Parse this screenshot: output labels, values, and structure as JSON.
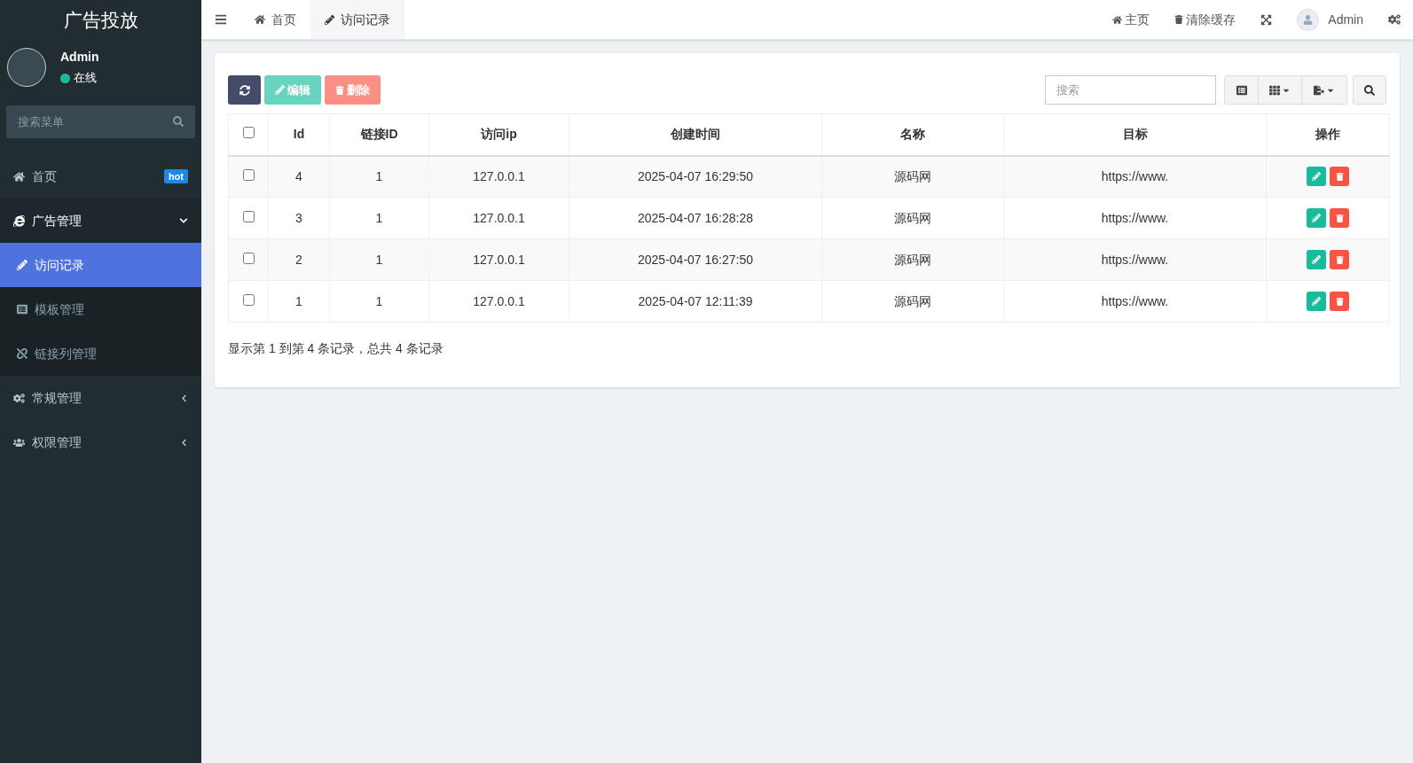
{
  "sidebar": {
    "logo": "广告投放",
    "user": {
      "name": "Admin",
      "status": "在线"
    },
    "search": {
      "placeholder": "搜索菜单"
    },
    "items": [
      {
        "label": "首页",
        "badge": "hot",
        "selected": false,
        "expanded": false
      },
      {
        "label": "广告管理",
        "selected": false,
        "expanded": true,
        "children": [
          {
            "label": "访问记录",
            "selected": true
          },
          {
            "label": "模板管理",
            "selected": false
          },
          {
            "label": "链接列管理",
            "selected": false
          }
        ]
      },
      {
        "label": "常规管理",
        "selected": false,
        "expanded": false
      },
      {
        "label": "权限管理",
        "selected": false,
        "expanded": false
      }
    ]
  },
  "topbar": {
    "tabs": [
      {
        "label": "首页",
        "selected": false
      },
      {
        "label": "访问记录",
        "selected": true
      }
    ],
    "links": [
      "主页",
      "清除缓存"
    ],
    "user": "Admin"
  },
  "toolbar": {
    "buttons": [
      {
        "label": "编辑",
        "disabled": true
      },
      {
        "label": "删除",
        "disabled": true
      }
    ],
    "search": {
      "placeholder": "搜索"
    }
  },
  "table": {
    "select_all_checked": false,
    "columns": [
      "Id",
      "链接ID",
      "访问ip",
      "创建时间",
      "名称",
      "目标",
      "操作"
    ],
    "rows": [
      {
        "checked": false,
        "cells": [
          "4",
          "1",
          "127.0.0.1",
          "2025-04-07 16:29:50",
          "源码网",
          "https://www."
        ]
      },
      {
        "checked": false,
        "cells": [
          "3",
          "1",
          "127.0.0.1",
          "2025-04-07 16:28:28",
          "源码网",
          "https://www."
        ]
      },
      {
        "checked": false,
        "cells": [
          "2",
          "1",
          "127.0.0.1",
          "2025-04-07 16:27:50",
          "源码网",
          "https://www."
        ]
      },
      {
        "checked": false,
        "cells": [
          "1",
          "1",
          "127.0.0.1",
          "2025-04-07 12:11:39",
          "源码网",
          "https://www."
        ]
      }
    ]
  },
  "pagination": {
    "summary": "显示第 1 到第 4 条记录，总共 4 条记录"
  }
}
